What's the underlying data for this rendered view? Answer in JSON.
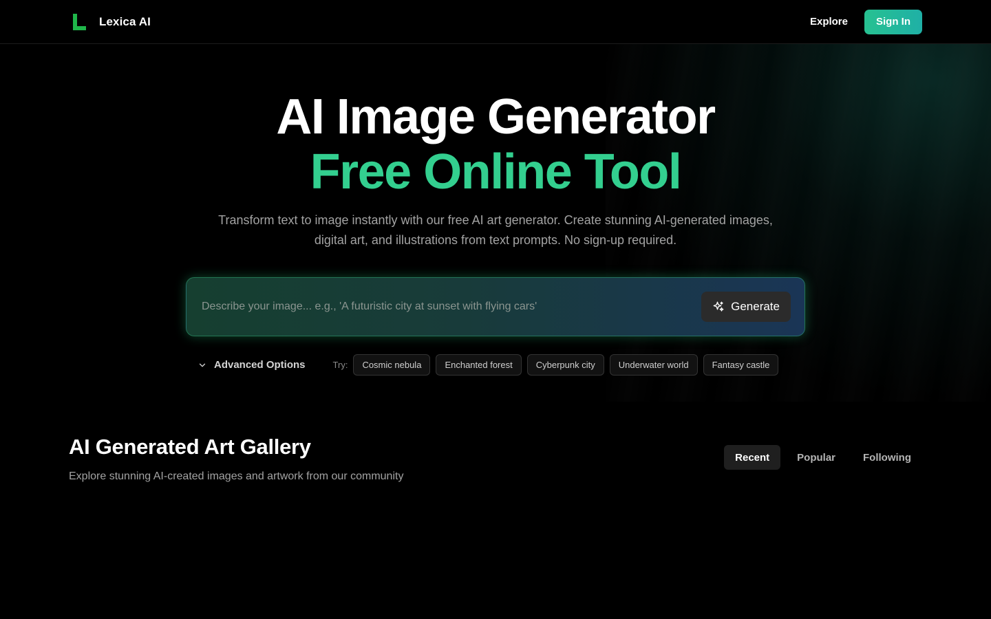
{
  "brand": {
    "name": "Lexica AI",
    "logo_icon": "lexica-logo-icon",
    "accent": "#1fb64a"
  },
  "nav": {
    "explore_label": "Explore",
    "signin_label": "Sign In"
  },
  "hero": {
    "title_line1": "AI Image Generator",
    "title_line2": "Free Online Tool",
    "subtitle": "Transform text to image instantly with our free AI art generator. Create stunning AI-generated images, digital art, and illustrations from text prompts. No sign-up required.",
    "title_accent_color": "#33cf8f"
  },
  "prompt": {
    "value": "",
    "placeholder": "Describe your image... e.g., 'A futuristic city at sunset with flying cars'",
    "generate_label": "Generate",
    "generate_icon": "sparkles-icon"
  },
  "options": {
    "advanced_label": "Advanced Options",
    "advanced_icon": "chevron-down-icon",
    "try_label": "Try:",
    "suggestions": [
      "Cosmic nebula",
      "Enchanted forest",
      "Cyberpunk city",
      "Underwater world",
      "Fantasy castle"
    ]
  },
  "gallery": {
    "title": "AI Generated Art Gallery",
    "subtitle": "Explore stunning AI-created images and artwork from our community",
    "tabs": [
      {
        "label": "Recent",
        "active": true
      },
      {
        "label": "Popular",
        "active": false
      },
      {
        "label": "Following",
        "active": false
      }
    ]
  }
}
